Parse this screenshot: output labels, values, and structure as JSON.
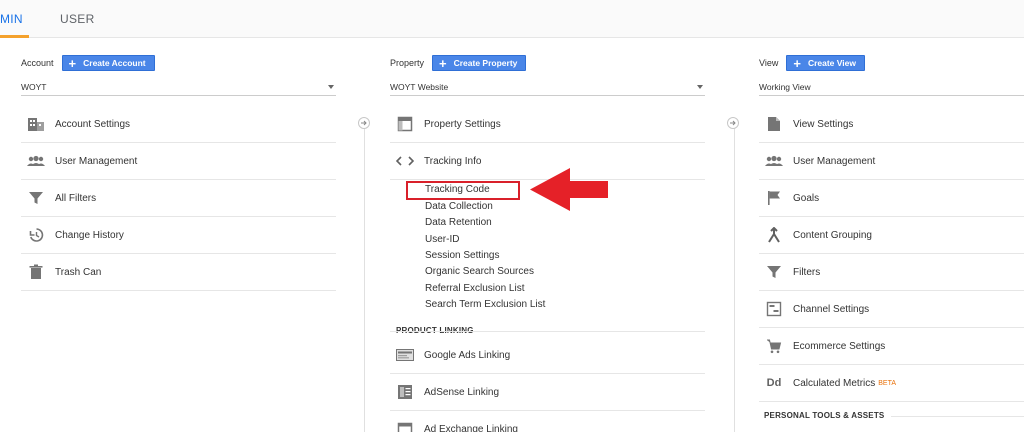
{
  "tabs": {
    "admin": "MIN",
    "user": "USER"
  },
  "account": {
    "label": "Account",
    "create_label": "Create Account",
    "selected": "WOYT",
    "items": [
      {
        "label": "Account Settings"
      },
      {
        "label": "User Management"
      },
      {
        "label": "All Filters"
      },
      {
        "label": "Change History"
      },
      {
        "label": "Trash Can"
      }
    ]
  },
  "property": {
    "label": "Property",
    "create_label": "Create Property",
    "selected": "WOYT Website",
    "items": [
      {
        "label": "Property Settings"
      },
      {
        "label": "Tracking Info"
      }
    ],
    "tracking_sub": [
      "Tracking Code",
      "Data Collection",
      "Data Retention",
      "User-ID",
      "Session Settings",
      "Organic Search Sources",
      "Referral Exclusion List",
      "Search Term Exclusion List"
    ],
    "product_linking_header": "PRODUCT LINKING",
    "linking_items": [
      {
        "label": "Google Ads Linking"
      },
      {
        "label": "AdSense Linking"
      },
      {
        "label": "Ad Exchange Linking"
      }
    ]
  },
  "view": {
    "label": "View",
    "create_label": "Create View",
    "selected": "Working View",
    "items": [
      {
        "label": "View Settings"
      },
      {
        "label": "User Management"
      },
      {
        "label": "Goals"
      },
      {
        "label": "Content Grouping"
      },
      {
        "label": "Filters"
      },
      {
        "label": "Channel Settings"
      },
      {
        "label": "Ecommerce Settings"
      },
      {
        "label": "Calculated Metrics"
      }
    ],
    "beta": "BETA",
    "personal_header": "PERSONAL TOOLS & ASSETS"
  },
  "colors": {
    "accent_blue": "#4a86e8",
    "tab_active": "#1a73e8",
    "tab_underline": "#f4a12c",
    "highlight_red": "#d9202a",
    "icon_grey": "#757575"
  },
  "icons": {
    "dd_glyph": "Dd"
  }
}
